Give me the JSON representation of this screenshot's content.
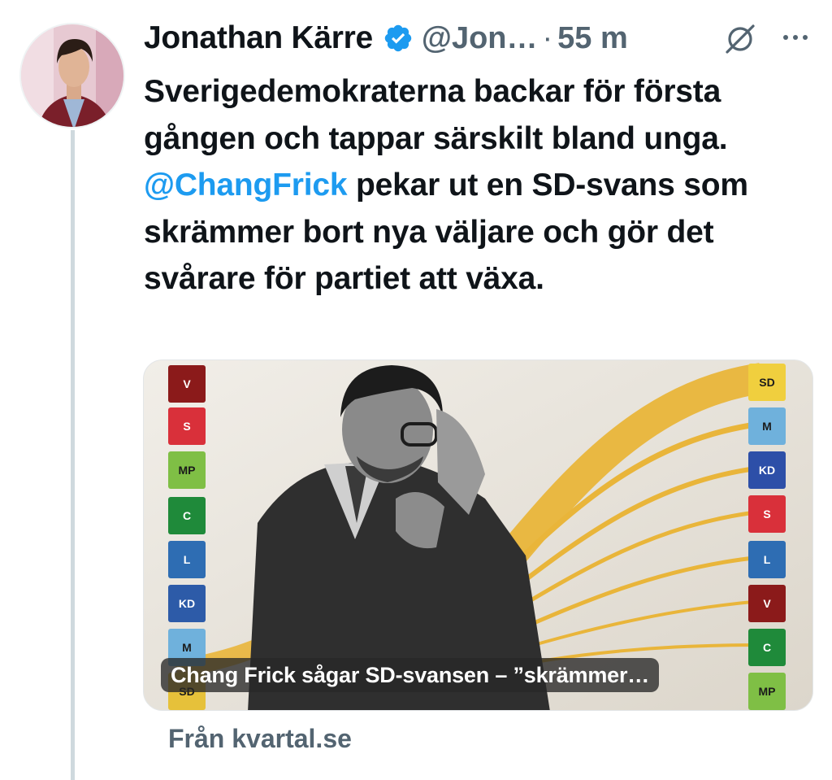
{
  "tweet": {
    "author_name": "Jonathan Kärre",
    "handle": "@Jon…",
    "separator": "·",
    "time": "55 m",
    "text_before_mention": "Sverigedemokraterna backar för första gången och tappar särskilt bland unga. ",
    "mention": "@ChangFrick",
    "text_after_mention": " pekar ut en SD-svans som skrämmer bort nya väljare och gör det svårare för partiet att växa.",
    "icons": {
      "verified": "verified-badge-icon",
      "grok": "grok-icon",
      "more": "more-icon"
    }
  },
  "card": {
    "caption": "Chang Frick sågar SD-svansen – ”skrämmer…",
    "source": "Från kvartal.se",
    "left_parties": [
      {
        "label": "V",
        "color": "#8b1a1a"
      },
      {
        "label": "S",
        "color": "#d9303a"
      },
      {
        "label": "MP",
        "color": "#7fbf45"
      },
      {
        "label": "C",
        "color": "#1f8a3a"
      },
      {
        "label": "L",
        "color": "#2e6db3"
      },
      {
        "label": "KD",
        "color": "#2d5ba8"
      },
      {
        "label": "M",
        "color": "#6fb1dc"
      },
      {
        "label": "SD",
        "color": "#e6c13a"
      }
    ],
    "right_parties": [
      {
        "label": "SD",
        "color": "#f0cf3e"
      },
      {
        "label": "M",
        "color": "#6fb1dc"
      },
      {
        "label": "KD",
        "color": "#2d4fa8"
      },
      {
        "label": "S",
        "color": "#d9303a"
      },
      {
        "label": "L",
        "color": "#2e6db3"
      },
      {
        "label": "V",
        "color": "#8b1a1a"
      },
      {
        "label": "C",
        "color": "#1f8a3a"
      },
      {
        "label": "MP",
        "color": "#7fbf45"
      }
    ]
  },
  "colors": {
    "accent": "#1d9bf0",
    "secondary_text": "#536471",
    "flow": "#e9b53a"
  }
}
